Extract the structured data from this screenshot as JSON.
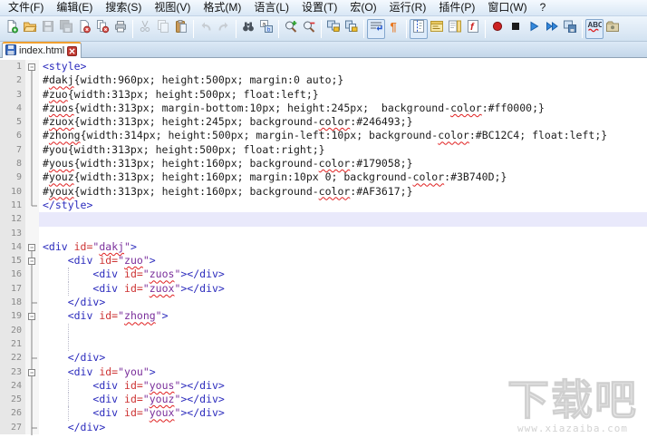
{
  "menu": {
    "items": [
      {
        "name": "file",
        "label": "文件(F)"
      },
      {
        "name": "edit",
        "label": "编辑(E)"
      },
      {
        "name": "search",
        "label": "搜索(S)"
      },
      {
        "name": "view",
        "label": "视图(V)"
      },
      {
        "name": "format",
        "label": "格式(M)"
      },
      {
        "name": "language",
        "label": "语言(L)"
      },
      {
        "name": "settings",
        "label": "设置(T)"
      },
      {
        "name": "macro",
        "label": "宏(O)"
      },
      {
        "name": "run",
        "label": "运行(R)"
      },
      {
        "name": "plugins",
        "label": "插件(P)"
      },
      {
        "name": "window",
        "label": "窗口(W)"
      },
      {
        "name": "help",
        "label": "?"
      }
    ]
  },
  "toolbar": {
    "groups": [
      {
        "buttons": [
          {
            "name": "new-file",
            "icon": "new-file-icon",
            "enabled": true,
            "pressed": false
          },
          {
            "name": "open-file",
            "icon": "open-folder-icon",
            "enabled": true,
            "pressed": false
          },
          {
            "name": "save",
            "icon": "save-icon",
            "enabled": false,
            "pressed": false
          },
          {
            "name": "save-all",
            "icon": "save-all-icon",
            "enabled": false,
            "pressed": false
          },
          {
            "name": "close",
            "icon": "close-doc-icon",
            "enabled": true,
            "pressed": false
          },
          {
            "name": "close-all",
            "icon": "close-all-icon",
            "enabled": true,
            "pressed": false
          },
          {
            "name": "print",
            "icon": "print-icon",
            "enabled": true,
            "pressed": false
          }
        ]
      },
      {
        "buttons": [
          {
            "name": "cut",
            "icon": "cut-icon",
            "enabled": false,
            "pressed": false
          },
          {
            "name": "copy",
            "icon": "copy-icon",
            "enabled": false,
            "pressed": false
          },
          {
            "name": "paste",
            "icon": "paste-icon",
            "enabled": true,
            "pressed": false
          }
        ]
      },
      {
        "buttons": [
          {
            "name": "undo",
            "icon": "undo-icon",
            "enabled": false,
            "pressed": false
          },
          {
            "name": "redo",
            "icon": "redo-icon",
            "enabled": false,
            "pressed": false
          }
        ]
      },
      {
        "buttons": [
          {
            "name": "find",
            "icon": "find-icon",
            "enabled": true,
            "pressed": false
          },
          {
            "name": "replace",
            "icon": "replace-icon",
            "enabled": true,
            "pressed": false
          }
        ]
      },
      {
        "buttons": [
          {
            "name": "zoom-in",
            "icon": "zoom-in-icon",
            "enabled": true,
            "pressed": false
          },
          {
            "name": "zoom-out",
            "icon": "zoom-out-icon",
            "enabled": true,
            "pressed": false
          }
        ]
      },
      {
        "buttons": [
          {
            "name": "sync-vertical-scroll",
            "icon": "sync-vertical-icon",
            "enabled": true,
            "pressed": false
          },
          {
            "name": "sync-horizontal-scroll",
            "icon": "sync-horizontal-icon",
            "enabled": true,
            "pressed": false
          }
        ]
      },
      {
        "buttons": [
          {
            "name": "word-wrap",
            "icon": "word-wrap-icon",
            "enabled": true,
            "pressed": true
          },
          {
            "name": "show-all-characters",
            "icon": "pilcrow-icon",
            "enabled": true,
            "pressed": false
          }
        ]
      },
      {
        "buttons": [
          {
            "name": "indent-guide",
            "icon": "indent-guide-icon",
            "enabled": true,
            "pressed": true
          },
          {
            "name": "user-defined-language",
            "icon": "udl-dialog-icon",
            "enabled": true,
            "pressed": false
          },
          {
            "name": "document-map",
            "icon": "doc-map-icon",
            "enabled": true,
            "pressed": false
          },
          {
            "name": "function-list",
            "icon": "function-list-icon",
            "enabled": true,
            "pressed": false
          }
        ]
      },
      {
        "buttons": [
          {
            "name": "macro-record",
            "icon": "record-icon",
            "enabled": true,
            "pressed": false
          },
          {
            "name": "macro-stop",
            "icon": "stop-icon",
            "enabled": true,
            "pressed": false
          },
          {
            "name": "macro-play",
            "icon": "play-icon",
            "enabled": true,
            "pressed": false
          },
          {
            "name": "macro-run-multiple",
            "icon": "play-multiple-icon",
            "enabled": true,
            "pressed": false
          },
          {
            "name": "macro-save",
            "icon": "save-macro-icon",
            "enabled": true,
            "pressed": false
          }
        ]
      },
      {
        "buttons": [
          {
            "name": "spell-check",
            "icon": "abc-spellcheck-icon",
            "enabled": true,
            "pressed": true
          },
          {
            "name": "spell-check-settings",
            "icon": "plugin-misc-icon",
            "enabled": true,
            "pressed": false
          }
        ]
      }
    ]
  },
  "tab_bar": {
    "tabs": [
      {
        "title": "index.html",
        "active": true,
        "saved": true
      }
    ]
  },
  "editor": {
    "colors": {
      "tag": "#2b2bbd",
      "attribute": "#cd3333",
      "value": "#7a2e9b",
      "text": "#1c1c1c",
      "misspell_underline": "#e02020",
      "current_line_bg": "#e9e9fb",
      "active_tab_accent": "#f0a030"
    },
    "lines": [
      {
        "n": 1,
        "fold": "start",
        "hl": false,
        "guide": false,
        "segs": [
          [
            "tag",
            "<style>"
          ]
        ]
      },
      {
        "n": 2,
        "fold": "line",
        "hl": false,
        "guide": false,
        "segs": [
          [
            "txt",
            "#"
          ],
          [
            "txt",
            "dakj",
            "m"
          ],
          [
            "txt",
            "{width:960px; height:500px; margin:0 auto;}"
          ]
        ]
      },
      {
        "n": 3,
        "fold": "line",
        "hl": false,
        "guide": false,
        "segs": [
          [
            "txt",
            "#"
          ],
          [
            "txt",
            "zuo",
            "m"
          ],
          [
            "txt",
            "{width:313px; height:500px; float:left;}"
          ]
        ]
      },
      {
        "n": 4,
        "fold": "line",
        "hl": false,
        "guide": false,
        "segs": [
          [
            "txt",
            "#"
          ],
          [
            "txt",
            "zuos",
            "m"
          ],
          [
            "txt",
            "{width:313px; margin-bottom:10px; height:245px;  background-"
          ],
          [
            "txt",
            "color",
            "m"
          ],
          [
            "txt",
            ":#ff0000;}"
          ]
        ]
      },
      {
        "n": 5,
        "fold": "line",
        "hl": false,
        "guide": false,
        "segs": [
          [
            "txt",
            "#"
          ],
          [
            "txt",
            "zuox",
            "m"
          ],
          [
            "txt",
            "{width:313px; height:245px; background-"
          ],
          [
            "txt",
            "color",
            "m"
          ],
          [
            "txt",
            ":#246493;}"
          ]
        ]
      },
      {
        "n": 6,
        "fold": "line",
        "hl": false,
        "guide": false,
        "segs": [
          [
            "txt",
            "#"
          ],
          [
            "txt",
            "zhong",
            "m"
          ],
          [
            "txt",
            "{width:314px; height:500px; margin-left:10px; background-"
          ],
          [
            "txt",
            "color",
            "m"
          ],
          [
            "txt",
            ":#BC12C4; float:left;}"
          ]
        ]
      },
      {
        "n": 7,
        "fold": "line",
        "hl": false,
        "guide": false,
        "segs": [
          [
            "txt",
            "#you{width:313px; height:500px; float:right;}"
          ]
        ]
      },
      {
        "n": 8,
        "fold": "line",
        "hl": false,
        "guide": false,
        "segs": [
          [
            "txt",
            "#"
          ],
          [
            "txt",
            "yous",
            "m"
          ],
          [
            "txt",
            "{width:313px; height:160px; background-"
          ],
          [
            "txt",
            "color",
            "m"
          ],
          [
            "txt",
            ":#179058;}"
          ]
        ]
      },
      {
        "n": 9,
        "fold": "line",
        "hl": false,
        "guide": false,
        "segs": [
          [
            "txt",
            "#"
          ],
          [
            "txt",
            "youz",
            "m"
          ],
          [
            "txt",
            "{width:313px; height:160px; margin:10px 0; background-"
          ],
          [
            "txt",
            "color",
            "m"
          ],
          [
            "txt",
            ":#3B740D;}"
          ]
        ]
      },
      {
        "n": 10,
        "fold": "line",
        "hl": false,
        "guide": false,
        "segs": [
          [
            "txt",
            "#"
          ],
          [
            "txt",
            "youx",
            "m"
          ],
          [
            "txt",
            "{width:313px; height:160px; background-"
          ],
          [
            "txt",
            "color",
            "m"
          ],
          [
            "txt",
            ":#AF3617;}"
          ]
        ]
      },
      {
        "n": 11,
        "fold": "end",
        "hl": false,
        "guide": false,
        "segs": [
          [
            "tag",
            "</style>"
          ]
        ]
      },
      {
        "n": 12,
        "fold": "",
        "hl": true,
        "guide": false,
        "segs": []
      },
      {
        "n": 13,
        "fold": "",
        "hl": false,
        "guide": false,
        "segs": []
      },
      {
        "n": 14,
        "fold": "start",
        "hl": false,
        "guide": false,
        "segs": [
          [
            "tag",
            "<div "
          ],
          [
            "attr",
            "id="
          ],
          [
            "val",
            "\""
          ],
          [
            "val",
            "dakj",
            "m"
          ],
          [
            "val",
            "\""
          ],
          [
            "tag",
            ">"
          ]
        ]
      },
      {
        "n": 15,
        "fold": "startc",
        "hl": false,
        "guide": false,
        "segs": [
          [
            "txt",
            "    "
          ],
          [
            "tag",
            "<div "
          ],
          [
            "attr",
            "id="
          ],
          [
            "val",
            "\""
          ],
          [
            "val",
            "zuo",
            "m"
          ],
          [
            "val",
            "\""
          ],
          [
            "tag",
            ">"
          ]
        ]
      },
      {
        "n": 16,
        "fold": "line",
        "hl": false,
        "guide": true,
        "segs": [
          [
            "txt",
            "        "
          ],
          [
            "tag",
            "<div "
          ],
          [
            "attr",
            "id="
          ],
          [
            "val",
            "\""
          ],
          [
            "val",
            "zuos",
            "m"
          ],
          [
            "val",
            "\""
          ],
          [
            "tag",
            "></div>"
          ]
        ]
      },
      {
        "n": 17,
        "fold": "line",
        "hl": false,
        "guide": true,
        "segs": [
          [
            "txt",
            "        "
          ],
          [
            "tag",
            "<div "
          ],
          [
            "attr",
            "id="
          ],
          [
            "val",
            "\""
          ],
          [
            "val",
            "zuox",
            "m"
          ],
          [
            "val",
            "\""
          ],
          [
            "tag",
            "></div>"
          ]
        ]
      },
      {
        "n": 18,
        "fold": "endc",
        "hl": false,
        "guide": false,
        "segs": [
          [
            "txt",
            "    "
          ],
          [
            "tag",
            "</div>"
          ]
        ]
      },
      {
        "n": 19,
        "fold": "startc",
        "hl": false,
        "guide": false,
        "segs": [
          [
            "txt",
            "    "
          ],
          [
            "tag",
            "<div "
          ],
          [
            "attr",
            "id="
          ],
          [
            "val",
            "\""
          ],
          [
            "val",
            "zhong",
            "m"
          ],
          [
            "val",
            "\""
          ],
          [
            "tag",
            ">"
          ]
        ]
      },
      {
        "n": 20,
        "fold": "line",
        "hl": false,
        "guide": true,
        "segs": []
      },
      {
        "n": 21,
        "fold": "line",
        "hl": false,
        "guide": true,
        "segs": []
      },
      {
        "n": 22,
        "fold": "endc",
        "hl": false,
        "guide": false,
        "segs": [
          [
            "txt",
            "    "
          ],
          [
            "tag",
            "</div>"
          ]
        ]
      },
      {
        "n": 23,
        "fold": "startc",
        "hl": false,
        "guide": false,
        "segs": [
          [
            "txt",
            "    "
          ],
          [
            "tag",
            "<div "
          ],
          [
            "attr",
            "id="
          ],
          [
            "val",
            "\""
          ],
          [
            "val",
            "you"
          ],
          [
            "val",
            "\""
          ],
          [
            "tag",
            ">"
          ]
        ]
      },
      {
        "n": 24,
        "fold": "line",
        "hl": false,
        "guide": true,
        "segs": [
          [
            "txt",
            "        "
          ],
          [
            "tag",
            "<div "
          ],
          [
            "attr",
            "id="
          ],
          [
            "val",
            "\""
          ],
          [
            "val",
            "yous",
            "m"
          ],
          [
            "val",
            "\""
          ],
          [
            "tag",
            "></div>"
          ]
        ]
      },
      {
        "n": 25,
        "fold": "line",
        "hl": false,
        "guide": true,
        "segs": [
          [
            "txt",
            "        "
          ],
          [
            "tag",
            "<div "
          ],
          [
            "attr",
            "id="
          ],
          [
            "val",
            "\""
          ],
          [
            "val",
            "youz",
            "m"
          ],
          [
            "val",
            "\""
          ],
          [
            "tag",
            "></div>"
          ]
        ]
      },
      {
        "n": 26,
        "fold": "line",
        "hl": false,
        "guide": true,
        "segs": [
          [
            "txt",
            "        "
          ],
          [
            "tag",
            "<div "
          ],
          [
            "attr",
            "id="
          ],
          [
            "val",
            "\""
          ],
          [
            "val",
            "youx",
            "m"
          ],
          [
            "val",
            "\""
          ],
          [
            "tag",
            "></div>"
          ]
        ]
      },
      {
        "n": 27,
        "fold": "endc",
        "hl": false,
        "guide": false,
        "segs": [
          [
            "txt",
            "    "
          ],
          [
            "tag",
            "</div>"
          ]
        ]
      }
    ]
  },
  "watermark": {
    "title": "下载吧",
    "url": "www.xiazaiba.com"
  }
}
